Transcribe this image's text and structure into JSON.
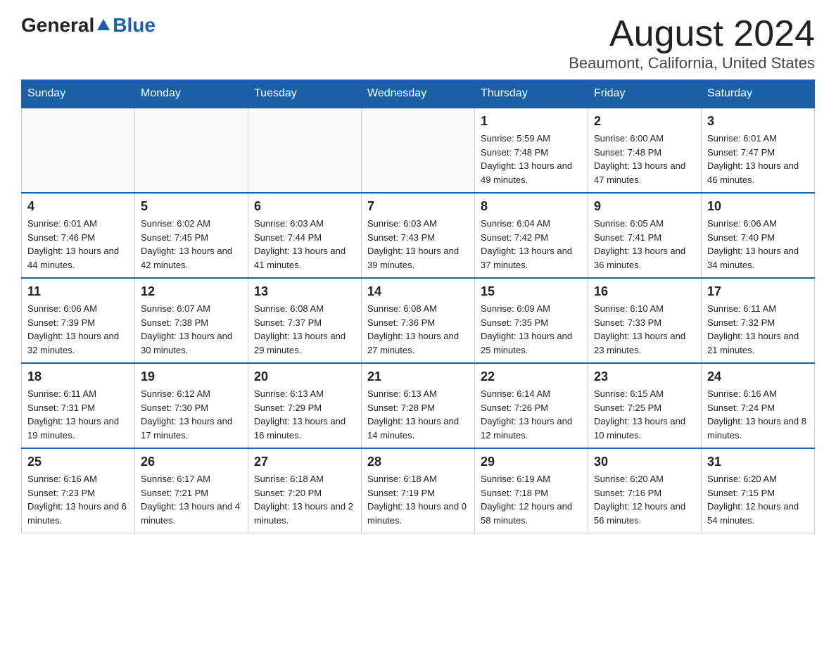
{
  "header": {
    "logo_general": "General",
    "logo_blue": "Blue",
    "month_title": "August 2024",
    "location": "Beaumont, California, United States"
  },
  "weekdays": [
    "Sunday",
    "Monday",
    "Tuesday",
    "Wednesday",
    "Thursday",
    "Friday",
    "Saturday"
  ],
  "weeks": [
    [
      {
        "day": "",
        "info": ""
      },
      {
        "day": "",
        "info": ""
      },
      {
        "day": "",
        "info": ""
      },
      {
        "day": "",
        "info": ""
      },
      {
        "day": "1",
        "info": "Sunrise: 5:59 AM\nSunset: 7:48 PM\nDaylight: 13 hours and 49 minutes."
      },
      {
        "day": "2",
        "info": "Sunrise: 6:00 AM\nSunset: 7:48 PM\nDaylight: 13 hours and 47 minutes."
      },
      {
        "day": "3",
        "info": "Sunrise: 6:01 AM\nSunset: 7:47 PM\nDaylight: 13 hours and 46 minutes."
      }
    ],
    [
      {
        "day": "4",
        "info": "Sunrise: 6:01 AM\nSunset: 7:46 PM\nDaylight: 13 hours and 44 minutes."
      },
      {
        "day": "5",
        "info": "Sunrise: 6:02 AM\nSunset: 7:45 PM\nDaylight: 13 hours and 42 minutes."
      },
      {
        "day": "6",
        "info": "Sunrise: 6:03 AM\nSunset: 7:44 PM\nDaylight: 13 hours and 41 minutes."
      },
      {
        "day": "7",
        "info": "Sunrise: 6:03 AM\nSunset: 7:43 PM\nDaylight: 13 hours and 39 minutes."
      },
      {
        "day": "8",
        "info": "Sunrise: 6:04 AM\nSunset: 7:42 PM\nDaylight: 13 hours and 37 minutes."
      },
      {
        "day": "9",
        "info": "Sunrise: 6:05 AM\nSunset: 7:41 PM\nDaylight: 13 hours and 36 minutes."
      },
      {
        "day": "10",
        "info": "Sunrise: 6:06 AM\nSunset: 7:40 PM\nDaylight: 13 hours and 34 minutes."
      }
    ],
    [
      {
        "day": "11",
        "info": "Sunrise: 6:06 AM\nSunset: 7:39 PM\nDaylight: 13 hours and 32 minutes."
      },
      {
        "day": "12",
        "info": "Sunrise: 6:07 AM\nSunset: 7:38 PM\nDaylight: 13 hours and 30 minutes."
      },
      {
        "day": "13",
        "info": "Sunrise: 6:08 AM\nSunset: 7:37 PM\nDaylight: 13 hours and 29 minutes."
      },
      {
        "day": "14",
        "info": "Sunrise: 6:08 AM\nSunset: 7:36 PM\nDaylight: 13 hours and 27 minutes."
      },
      {
        "day": "15",
        "info": "Sunrise: 6:09 AM\nSunset: 7:35 PM\nDaylight: 13 hours and 25 minutes."
      },
      {
        "day": "16",
        "info": "Sunrise: 6:10 AM\nSunset: 7:33 PM\nDaylight: 13 hours and 23 minutes."
      },
      {
        "day": "17",
        "info": "Sunrise: 6:11 AM\nSunset: 7:32 PM\nDaylight: 13 hours and 21 minutes."
      }
    ],
    [
      {
        "day": "18",
        "info": "Sunrise: 6:11 AM\nSunset: 7:31 PM\nDaylight: 13 hours and 19 minutes."
      },
      {
        "day": "19",
        "info": "Sunrise: 6:12 AM\nSunset: 7:30 PM\nDaylight: 13 hours and 17 minutes."
      },
      {
        "day": "20",
        "info": "Sunrise: 6:13 AM\nSunset: 7:29 PM\nDaylight: 13 hours and 16 minutes."
      },
      {
        "day": "21",
        "info": "Sunrise: 6:13 AM\nSunset: 7:28 PM\nDaylight: 13 hours and 14 minutes."
      },
      {
        "day": "22",
        "info": "Sunrise: 6:14 AM\nSunset: 7:26 PM\nDaylight: 13 hours and 12 minutes."
      },
      {
        "day": "23",
        "info": "Sunrise: 6:15 AM\nSunset: 7:25 PM\nDaylight: 13 hours and 10 minutes."
      },
      {
        "day": "24",
        "info": "Sunrise: 6:16 AM\nSunset: 7:24 PM\nDaylight: 13 hours and 8 minutes."
      }
    ],
    [
      {
        "day": "25",
        "info": "Sunrise: 6:16 AM\nSunset: 7:23 PM\nDaylight: 13 hours and 6 minutes."
      },
      {
        "day": "26",
        "info": "Sunrise: 6:17 AM\nSunset: 7:21 PM\nDaylight: 13 hours and 4 minutes."
      },
      {
        "day": "27",
        "info": "Sunrise: 6:18 AM\nSunset: 7:20 PM\nDaylight: 13 hours and 2 minutes."
      },
      {
        "day": "28",
        "info": "Sunrise: 6:18 AM\nSunset: 7:19 PM\nDaylight: 13 hours and 0 minutes."
      },
      {
        "day": "29",
        "info": "Sunrise: 6:19 AM\nSunset: 7:18 PM\nDaylight: 12 hours and 58 minutes."
      },
      {
        "day": "30",
        "info": "Sunrise: 6:20 AM\nSunset: 7:16 PM\nDaylight: 12 hours and 56 minutes."
      },
      {
        "day": "31",
        "info": "Sunrise: 6:20 AM\nSunset: 7:15 PM\nDaylight: 12 hours and 54 minutes."
      }
    ]
  ]
}
